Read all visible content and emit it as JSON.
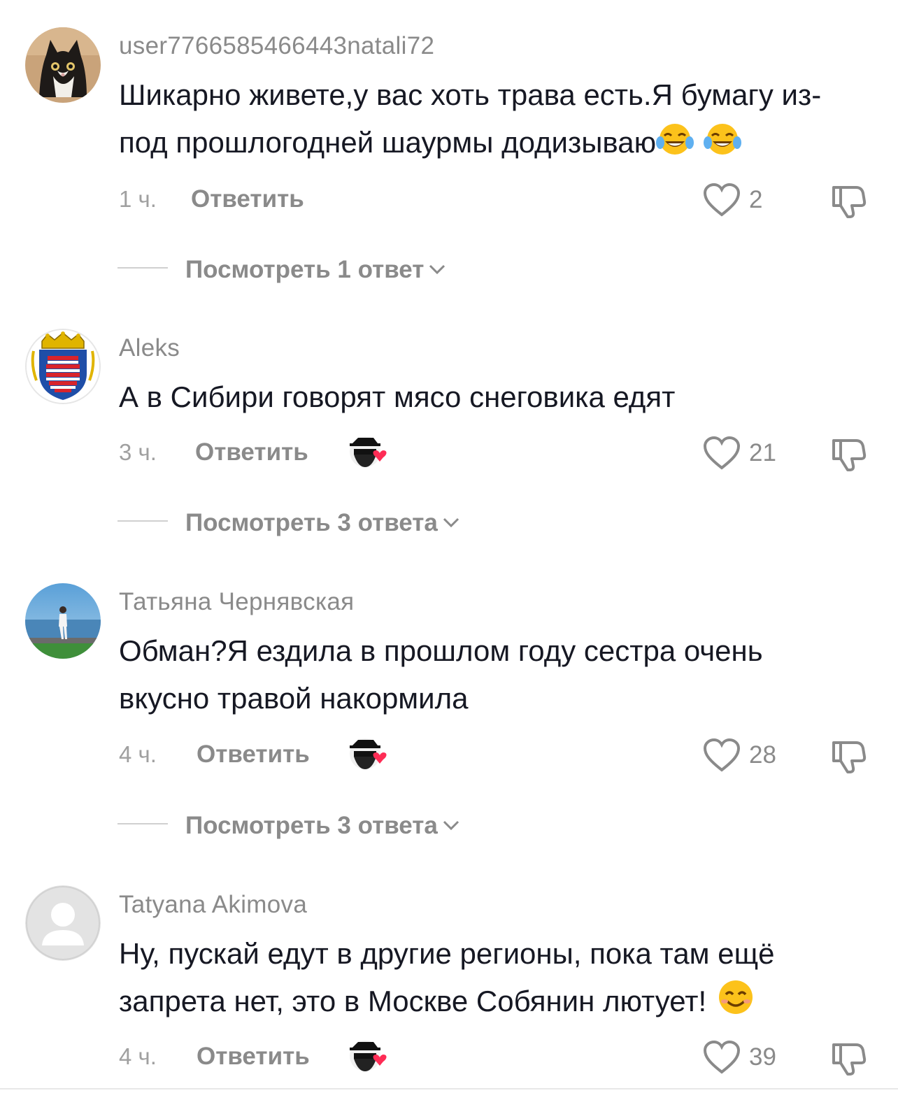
{
  "comments": [
    {
      "username": "user7766585466443natali72",
      "avatar": "cat-avatar",
      "text": "Шикарно живете,у вас хоть трава есть.Я бумагу из-под прошлогодней шаурмы додизываю",
      "text_emojis": [
        "face-with-tears-of-joy",
        "face-with-tears-of-joy"
      ],
      "time": "1 ч.",
      "reply_label": "Ответить",
      "creator_liked": false,
      "likes": "2",
      "replies_label": "Посмотреть 1 ответ"
    },
    {
      "username": "Aleks",
      "avatar": "coat-of-arms-avatar",
      "text": "А в Сибири говорят мясо снеговика едят",
      "time": "3 ч.",
      "reply_label": "Ответить",
      "creator_liked": true,
      "likes": "21",
      "replies_label": "Посмотреть 3 ответа"
    },
    {
      "username": "Татьяна Чернявская",
      "avatar": "seaside-photo-avatar",
      "text": "Обман?Я ездила в прошлом году сестра очень вкусно травой накормила",
      "time": "4 ч.",
      "reply_label": "Ответить",
      "creator_liked": true,
      "likes": "28",
      "replies_label": "Посмотреть 3 ответа"
    },
    {
      "username": "Tatyana Akimova",
      "avatar": "default-user-avatar",
      "text": "Ну, пускай едут в другие регионы, пока там ещё запрета нет, это в Москве Собянин лютует!",
      "text_emojis": [
        "smiling-face"
      ],
      "time": "4 ч.",
      "reply_label": "Ответить",
      "creator_liked": true,
      "likes": "39"
    }
  ],
  "colors": {
    "text": "#161823",
    "muted": "#8a8a8a",
    "heart_red": "#fe2c55"
  }
}
